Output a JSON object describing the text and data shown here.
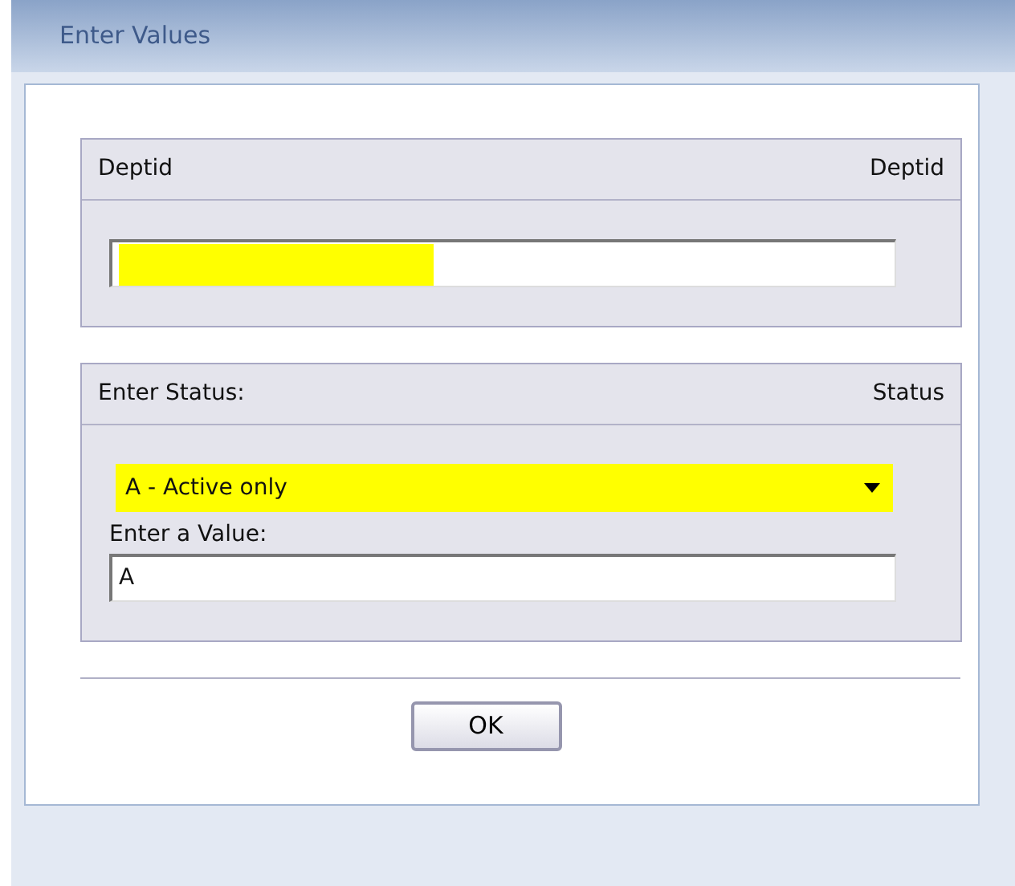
{
  "window": {
    "title": "Enter Values"
  },
  "groups": [
    {
      "label": "Deptid",
      "field_name": "Deptid",
      "kind": "text"
    },
    {
      "label": "Enter Status:",
      "field_name": "Status",
      "kind": "select",
      "value": "A - Active only",
      "value_label": "Enter a Value:",
      "entry": "A"
    }
  ],
  "buttons": [
    "OK"
  ]
}
